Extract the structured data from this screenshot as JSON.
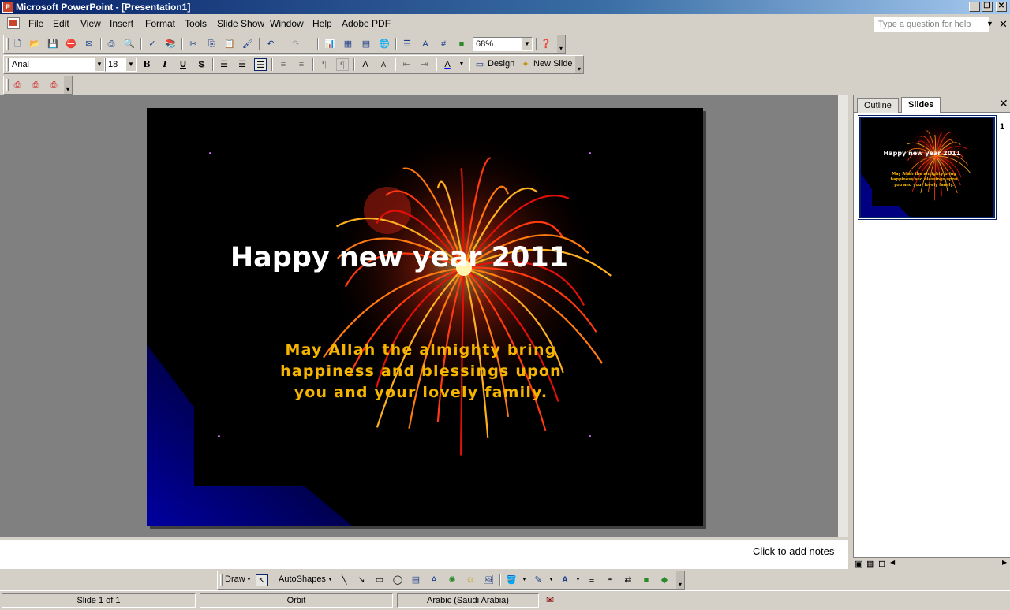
{
  "window": {
    "title": "Microsoft PowerPoint - [Presentation1]",
    "controls": [
      "_",
      "❐",
      "✕"
    ]
  },
  "menu": {
    "items": [
      "File",
      "Edit",
      "View",
      "Insert",
      "Format",
      "Tools",
      "Slide Show",
      "Window",
      "Help",
      "Adobe PDF"
    ],
    "help_placeholder": "Type a question for help"
  },
  "standard_toolbar": {
    "zoom": "68%"
  },
  "formatting_toolbar": {
    "font": "Arial",
    "size": "18",
    "bold": "B",
    "italic": "I",
    "underline": "U",
    "shadow": "S",
    "design_label": "Design",
    "new_slide_label": "New Slide"
  },
  "slide": {
    "title": "Happy new year 2011",
    "body": [
      "May Allah the almighty bring",
      "happiness and blessings upon",
      "you and your lovely family."
    ]
  },
  "notes": {
    "placeholder": "Click to add notes"
  },
  "side_pane": {
    "tabs": [
      "Outline",
      "Slides"
    ],
    "active_tab": "Slides",
    "thumbnail_number": "1"
  },
  "draw_toolbar": {
    "draw_label": "Draw",
    "autoshapes_label": "AutoShapes"
  },
  "status": {
    "slide": "Slide 1 of 1",
    "design": "Orbit",
    "language": "Arabic (Saudi Arabia)"
  },
  "colors": {
    "title_bar": "#0a246a",
    "slide_title": "#ffffff",
    "slide_body": "#f5b400",
    "slide_bg": "#000000"
  }
}
